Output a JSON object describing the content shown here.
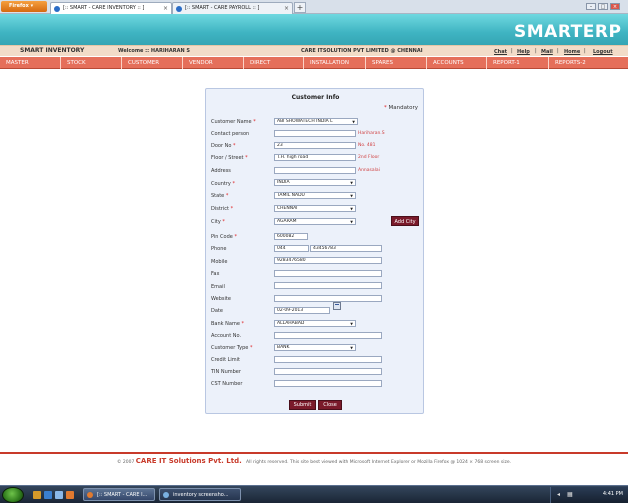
{
  "browser": {
    "menu_label": "Firefox",
    "tabs": [
      {
        "label": "[:: SMART - CARE INVENTORY :: ]",
        "active": true
      },
      {
        "label": "[:: SMART - CARE PAYROLL :: ]",
        "active": false
      }
    ],
    "new_tab": "+",
    "close_glyph": "×"
  },
  "header": {
    "logo_smart": "SMART",
    "logo_erp": "ERP",
    "app_title": "SMART INVENTORY",
    "welcome": "Welcome :: HARIHARAN S",
    "company": "CARE ITSOLUTION PVT LIMITED @ CHENNAI",
    "links": [
      "Chat",
      "Help",
      "Mail",
      "Home",
      "Logout"
    ],
    "separator": "|"
  },
  "menu": [
    "MASTER",
    "STOCK",
    "CUSTOMER",
    "VENDOR",
    "DIRECT",
    "INSTALLATION",
    "SPARES",
    "ACCOUNTS",
    "REPORT-1",
    "REPORTS-2"
  ],
  "form": {
    "title": "Customer Info",
    "mandatory_label": "Mandatory",
    "required_mark": "*",
    "fields": {
      "customer_name": {
        "label": "Customer Name",
        "value": "ABI SHOWATECH INDIA L"
      },
      "contact_person": {
        "label": "Contact person",
        "value": "",
        "hint": "Hariharan.S"
      },
      "door_no": {
        "label": "Door No",
        "value": "23",
        "hint": "No. 481"
      },
      "floor_street": {
        "label": "Floor / Street",
        "value": "T.H. high road",
        "hint": "2nd Floor"
      },
      "address": {
        "label": "Address",
        "value": "",
        "hint": "Annasalai"
      },
      "country": {
        "label": "Country",
        "value": "INDIA"
      },
      "state": {
        "label": "State",
        "value": "TAMIL NADU"
      },
      "district": {
        "label": "District",
        "value": "CHENNAI"
      },
      "city": {
        "label": "City",
        "value": "AGARAM"
      },
      "pin_code": {
        "label": "Pin Code",
        "value": "600082"
      },
      "phone": {
        "label": "Phone",
        "code": "044",
        "value": "43456783"
      },
      "mobile": {
        "label": "Mobile",
        "value": "9283476580"
      },
      "fax": {
        "label": "Fax",
        "value": ""
      },
      "email": {
        "label": "Email",
        "value": ""
      },
      "website": {
        "label": "Website",
        "value": ""
      },
      "date": {
        "label": "Date",
        "value": "02-09-2013"
      },
      "bank_name": {
        "label": "Bank Name",
        "value": "ALLAHABAD"
      },
      "account_no": {
        "label": "Account No.",
        "value": ""
      },
      "customer_type": {
        "label": "Customer Type",
        "value": "BANK"
      },
      "credit_limit": {
        "label": "Credit Limit",
        "value": ""
      },
      "tin_number": {
        "label": "TIN Number",
        "value": ""
      },
      "cst_number": {
        "label": "CST Number",
        "value": ""
      }
    },
    "add_city_label": "Add City",
    "submit_label": "Submit",
    "close_label": "Close"
  },
  "footer": {
    "copyright": "© 2007",
    "brand": "CARE IT Solutions Pvt. Ltd.",
    "rights": "All rights reserved.   This site best viewed with Microsoft Internet Explorer or Mozilla Firefox @ 1024 × 768 screen size."
  },
  "taskbar": {
    "tasks": [
      "[:: SMART - CARE I...",
      "inventory screensho..."
    ],
    "clock": "4:41 PM"
  },
  "colors": {
    "banner": "#3fb4c2",
    "menu": "#e56f5a",
    "button": "#7a1a2a",
    "required": "#e02020",
    "footer_brand": "#c83a2a"
  }
}
